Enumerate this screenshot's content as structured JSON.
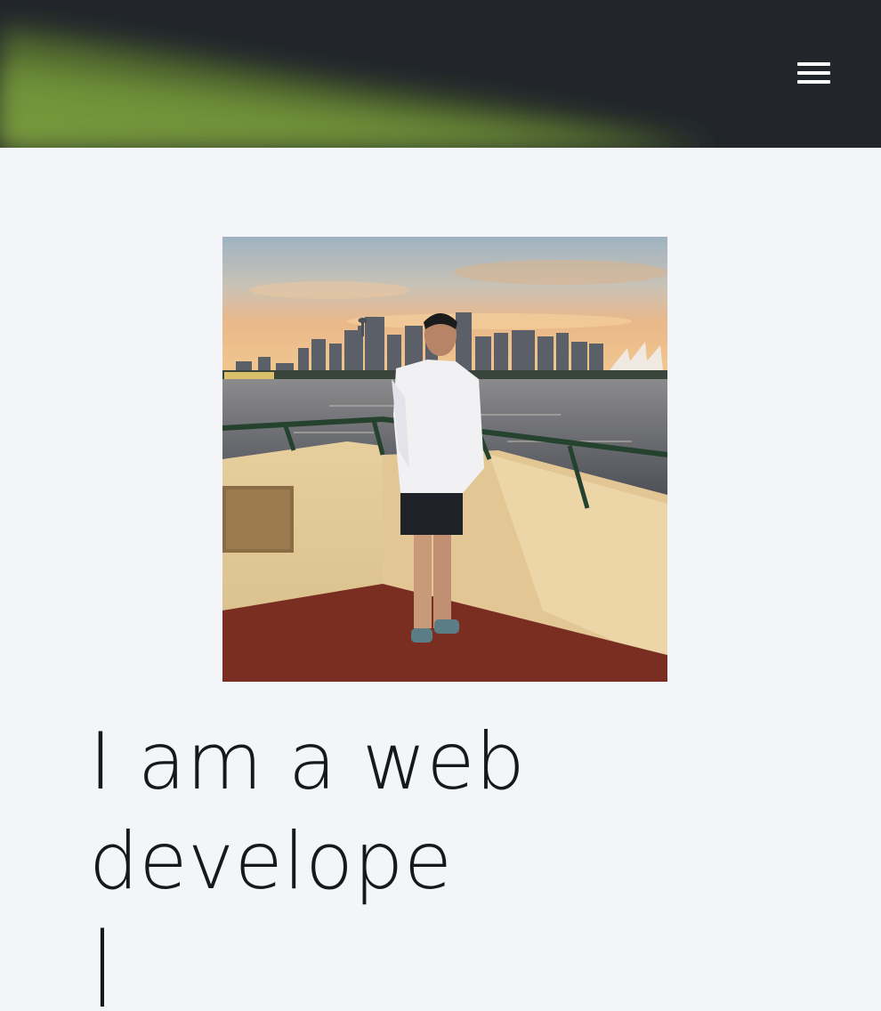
{
  "header": {
    "menu_icon": "hamburger-menu-icon",
    "accent_color": "#6e8f3a",
    "background_color": "#22262b"
  },
  "profile_photo": {
    "description_icon": "profile-photo"
  },
  "hero": {
    "line1": "I am a web",
    "line2": "develope",
    "cursor": "|"
  }
}
